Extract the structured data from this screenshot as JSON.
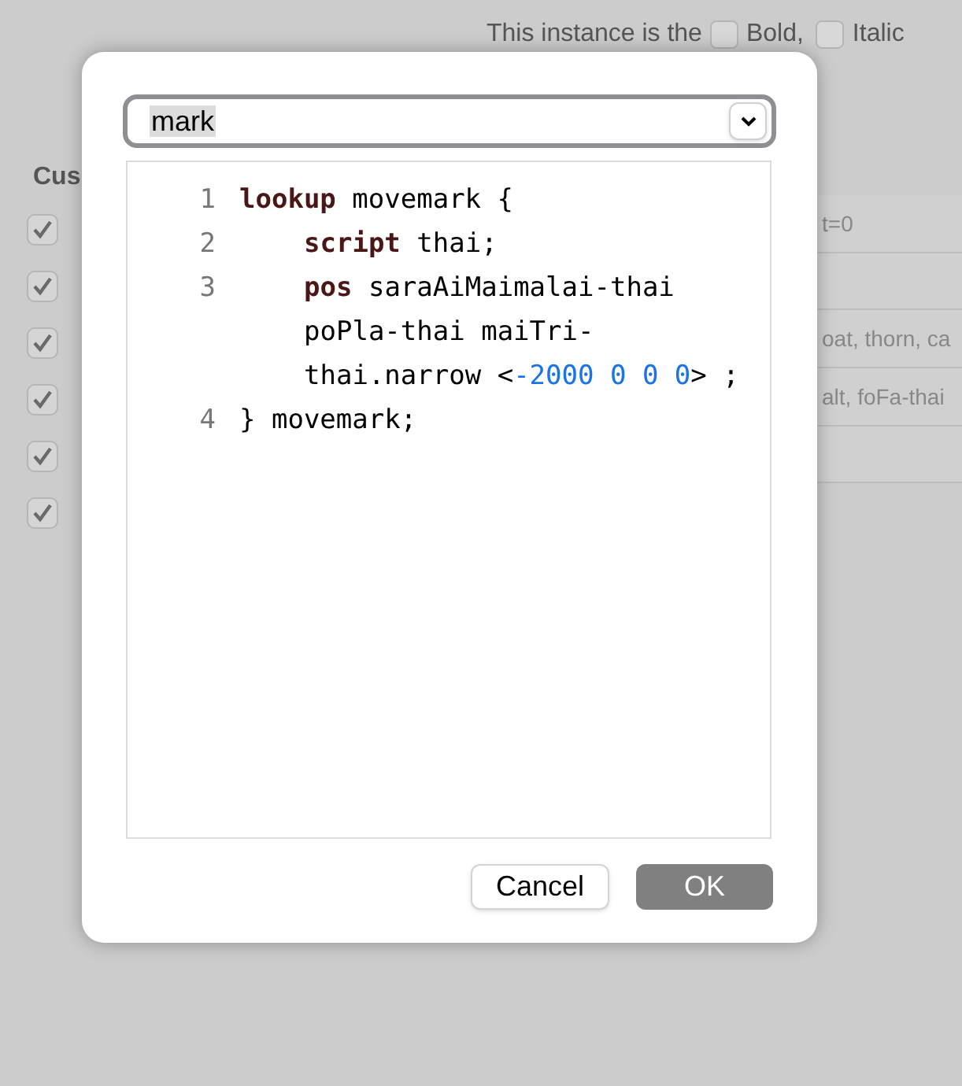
{
  "background": {
    "heading": "Cus",
    "instance_label": "This instance is the",
    "style_options": [
      {
        "label": "Bold,",
        "checked": false
      },
      {
        "label": "Italic",
        "checked": false
      }
    ],
    "checkboxes": [
      {
        "checked": true
      },
      {
        "checked": true
      },
      {
        "checked": true
      },
      {
        "checked": true
      },
      {
        "checked": true
      },
      {
        "checked": true
      }
    ],
    "rows": [
      {
        "text": "t=0"
      },
      {
        "text": ""
      },
      {
        "text": "oat, thorn, ca"
      },
      {
        "text": "alt, foFa-thai"
      },
      {
        "text": ""
      }
    ]
  },
  "dialog": {
    "combo": {
      "value": "mark"
    },
    "code_lines": [
      {
        "number": "1",
        "indented": false,
        "tokens": [
          {
            "kind": "keyword",
            "text": "lookup"
          },
          {
            "kind": "plain",
            "text": " movemark {"
          }
        ]
      },
      {
        "number": "2",
        "indented": true,
        "tokens": [
          {
            "kind": "keyword",
            "text": "script"
          },
          {
            "kind": "plain",
            "text": " thai;"
          }
        ]
      },
      {
        "number": "3",
        "indented": true,
        "tokens": [
          {
            "kind": "keyword",
            "text": "pos"
          },
          {
            "kind": "plain",
            "text": " saraAiMaimalai-thai poPla-thai maiTri-thai.narrow <"
          },
          {
            "kind": "number",
            "text": "-2000 0 0 0"
          },
          {
            "kind": "plain",
            "text": "> ;"
          }
        ]
      },
      {
        "number": "4",
        "indented": false,
        "tokens": [
          {
            "kind": "plain",
            "text": "} movemark;"
          }
        ]
      }
    ],
    "buttons": [
      {
        "label": "Cancel",
        "kind": "secondary"
      },
      {
        "label": "OK",
        "kind": "primary"
      }
    ]
  }
}
